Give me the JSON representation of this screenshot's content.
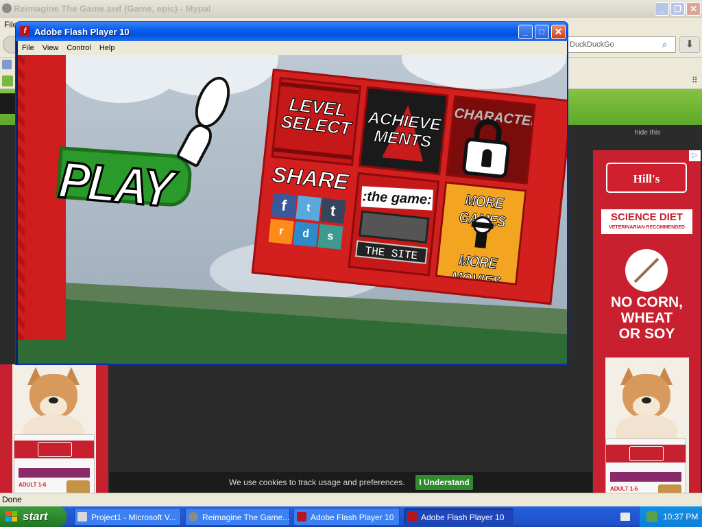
{
  "browser": {
    "title": "Reimagine The Game.swf (Game, epic) - Mypal",
    "menu_first": "File",
    "search_placeholder": "DuckDuckGo",
    "hide_label": "hide this",
    "status": "Done"
  },
  "ads": {
    "right": {
      "brand": "Hill's",
      "tagline": "SCIENCE DIET",
      "sub": "VETERINARIAN RECOMMENDED",
      "claim": [
        "NO CORN,",
        "WHEAT",
        "OR SOY"
      ],
      "bag_label": "ADULT 1-6"
    },
    "left": {
      "brand": "Hill's",
      "tagline": "SCIENCE DIET",
      "bag_label": "ADULT 1-6"
    }
  },
  "cookie": {
    "text": "We use cookies to track usage and preferences.",
    "button": "I Understand"
  },
  "flash_window": {
    "title": "Adobe Flash Player 10",
    "menu": [
      "File",
      "View",
      "Control",
      "Help"
    ]
  },
  "game": {
    "play": "PLAY",
    "tiles": {
      "level": [
        "LEVEL",
        "SELECT"
      ],
      "achievements": [
        "ACHIEVE",
        "MENTS"
      ],
      "character": "CHARACTER",
      "share": "SHARE",
      "the_game": ":the game:",
      "the_site": "THE SITE",
      "more_games": "MORE GAMES",
      "more_movies": "MORE MOVIES"
    },
    "social": [
      "f",
      "t",
      "t",
      "r",
      "d",
      "s"
    ]
  },
  "taskbar": {
    "start": "start",
    "tasks": [
      {
        "label": "Project1 - Microsoft V...",
        "active": false
      },
      {
        "label": "Reimagine The Game....",
        "active": false
      },
      {
        "label": "Adobe Flash Player 10",
        "active": false
      },
      {
        "label": "Adobe Flash Player 10",
        "active": true
      }
    ],
    "clock": "10:37 PM"
  },
  "colors": {
    "xp_blue": "#0a5ef0",
    "start_green": "#2f8a2f",
    "game_red": "#d41f1f",
    "play_green": "#2a9a2a",
    "ad_red": "#c8202f"
  }
}
